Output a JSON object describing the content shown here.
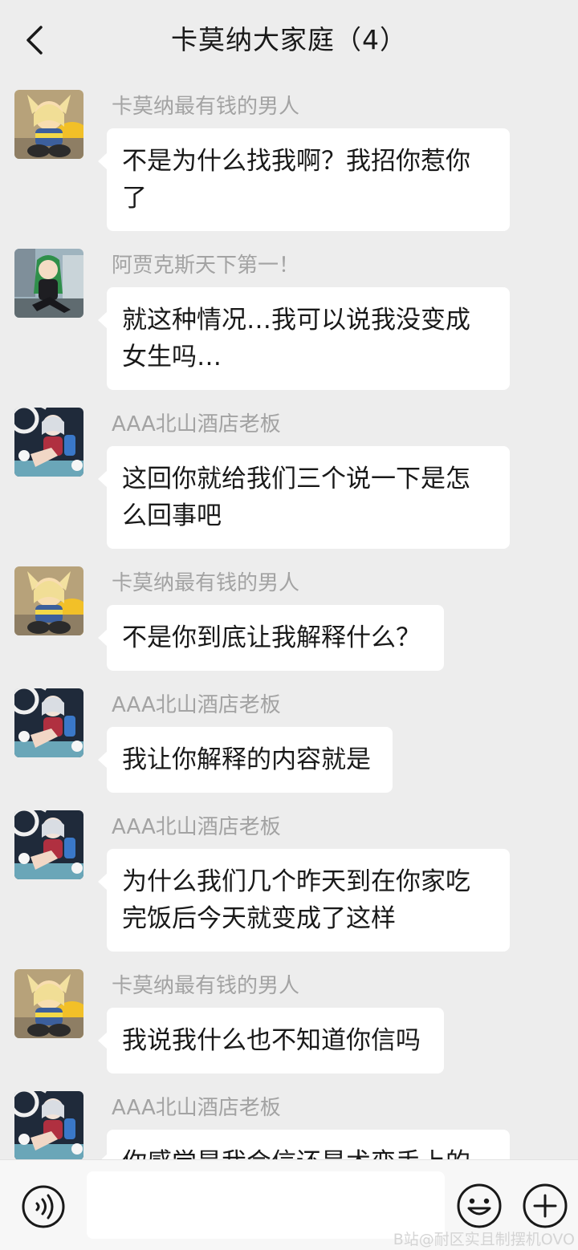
{
  "header": {
    "title": "卡莫纳大家庭（4）",
    "back_icon": "chevron-left-icon"
  },
  "messages": [
    {
      "sender": "卡莫纳最有钱的男人",
      "avatar": "blonde-catgirl",
      "text": "不是为什么找我啊？我招你惹你了"
    },
    {
      "sender": "阿贾克斯天下第一！",
      "avatar": "green-hair-girl",
      "text": "就这种情况…我可以说我没变成女生吗…"
    },
    {
      "sender": "AAA北山酒店老板",
      "avatar": "silver-hair-girl",
      "text": "这回你就给我们三个说一下是怎么回事吧"
    },
    {
      "sender": "卡莫纳最有钱的男人",
      "avatar": "blonde-catgirl",
      "text": "不是你到底让我解释什么？"
    },
    {
      "sender": "AAA北山酒店老板",
      "avatar": "silver-hair-girl",
      "text": "我让你解释的内容就是"
    },
    {
      "sender": "AAA北山酒店老板",
      "avatar": "silver-hair-girl",
      "text": "为什么我们几个昨天到在你家吃完饭后今天就变成了这样"
    },
    {
      "sender": "卡莫纳最有钱的男人",
      "avatar": "blonde-catgirl",
      "text": "我说我什么也不知道你信吗"
    },
    {
      "sender": "AAA北山酒店老板",
      "avatar": "silver-hair-girl",
      "text": "你感觉是我会信还是术变手上的"
    }
  ],
  "input_bar": {
    "voice_icon": "voice-icon",
    "input_value": "",
    "emoji_icon": "emoji-icon",
    "plus_icon": "plus-circle-icon"
  },
  "watermark": "B站@耐区实且制摆机OVO",
  "colors": {
    "background": "#ededed",
    "bubble": "#ffffff",
    "sender_name": "#a3a3a3",
    "text": "#191919"
  }
}
